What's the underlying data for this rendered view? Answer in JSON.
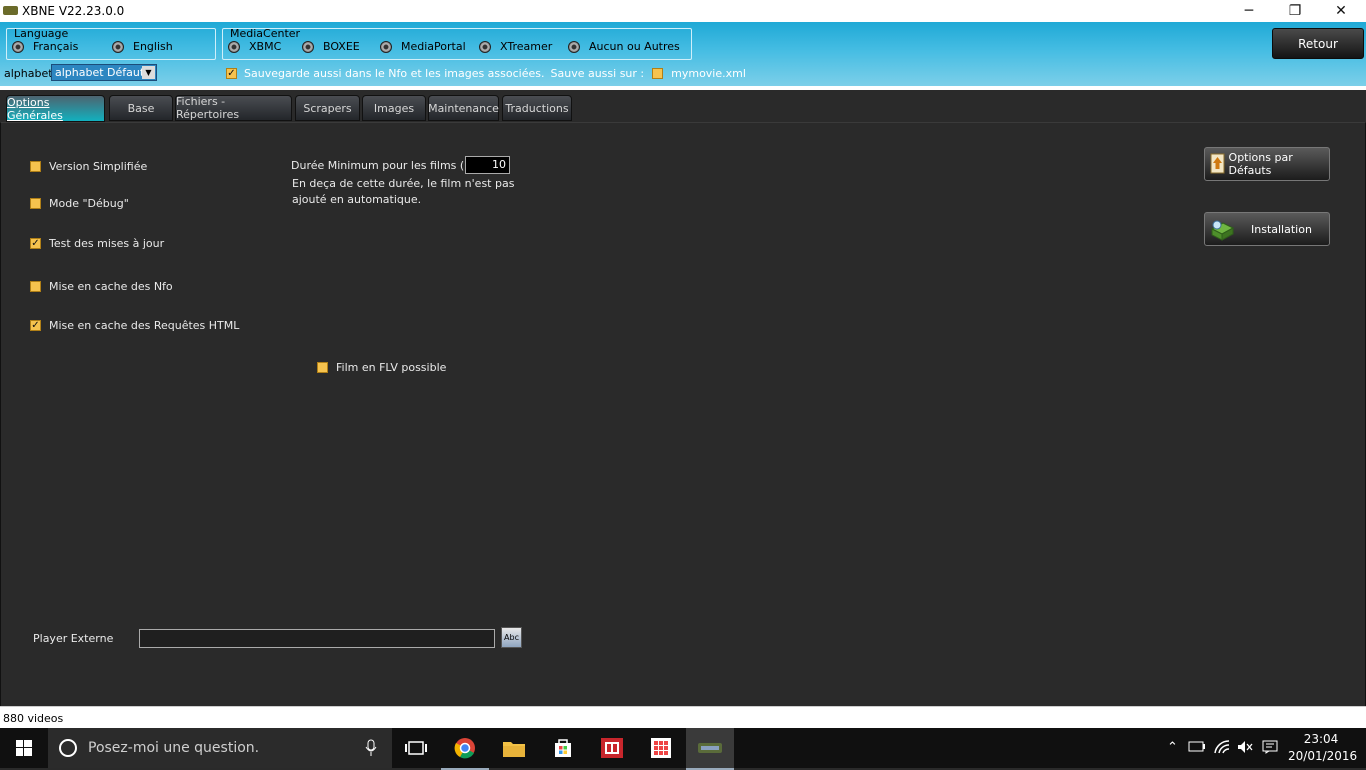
{
  "window": {
    "title": "XBNE V22.23.0.0",
    "minimize": "─",
    "restore": "❐",
    "close": "✕"
  },
  "language": {
    "legend": "Language",
    "options": [
      "Français",
      "English"
    ]
  },
  "mediacenter": {
    "legend": "MediaCenter",
    "options": [
      "XBMC",
      "BOXEE",
      "MediaPortal",
      "XTreamer",
      "Aucun ou Autres"
    ]
  },
  "retour_label": "Retour",
  "alphabet": {
    "label": "alphabet",
    "value": "alphabet Défaut"
  },
  "nfo": {
    "label": "Sauvegarde aussi dans le Nfo et les images associées.",
    "save_also_label": "Sauve aussi sur :",
    "mymovie_label": "mymovie.xml",
    "checked": true,
    "mymovie_checked": false
  },
  "tabs": [
    "Options Générales",
    "Base",
    "Fichiers - Répertoires",
    "Scrapers",
    "Images",
    "Maintenance",
    "Traductions"
  ],
  "options": [
    {
      "label": "Version Simplifiée",
      "checked": false
    },
    {
      "label": "Mode \"Débug\"",
      "checked": false
    },
    {
      "label": "Test des mises à jour",
      "checked": true
    },
    {
      "label": "Mise en cache des Nfo",
      "checked": false
    },
    {
      "label": "Mise en cache des Requêtes HTML",
      "checked": true
    }
  ],
  "duree": {
    "label": "Durée Minimum pour les films (mn)",
    "value": "10",
    "help1": "En deça de cette durée, le film n'est pas",
    "help2": "ajouté en automatique."
  },
  "flv": {
    "label": "Film en FLV possible",
    "checked": false
  },
  "buttons": {
    "defaults": "Options par Défauts",
    "installation": "Installation"
  },
  "player": {
    "label": "Player Externe",
    "value": "",
    "browse_icon": "Abc"
  },
  "status": {
    "text": "880 videos"
  },
  "taskbar": {
    "search_placeholder": "Posez-moi une question.",
    "time": "23:04",
    "date": "20/01/2016"
  },
  "colors": {
    "header": "#46bde3",
    "tab_active": "#12b1bf",
    "checkbox": "#f6c34e",
    "content_bg": "#2a2a2a"
  }
}
